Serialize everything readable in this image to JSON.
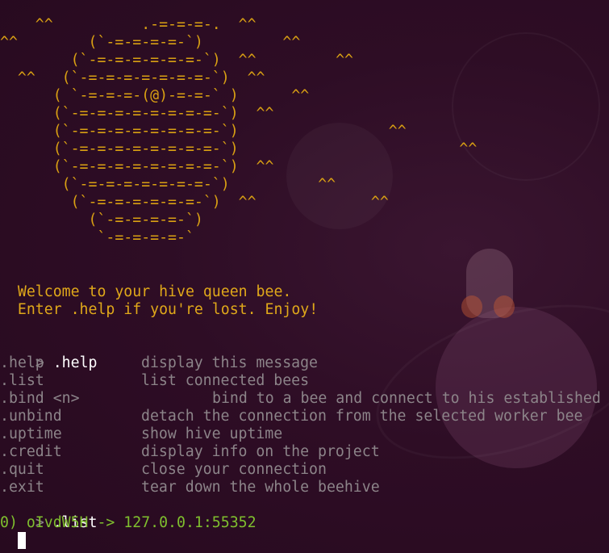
{
  "colors": {
    "background": "#2c0b22",
    "ascii_art": "#d9a013",
    "welcome_text": "#e0a81a",
    "command_text": "#ffffff",
    "help_text": "#8c8489",
    "result_text": "#7fbf2e",
    "prompt": "#8a7f86"
  },
  "ascii_art": [
    "    ^^          .-=-=-=-.  ^^",
    "^^        (`-=-=-=-=-`)         ^^",
    "        (`-=-=-=-=-=-=-`)  ^^         ^^",
    "  ^^   (`-=-=-=-=-=-=-=-`)  ^^",
    "      ( `-=-=-=-(@)-=-=-` )      ^^",
    "      (`-=-=-=-=-=-=-=-=-`)  ^^",
    "      (`-=-=-=-=-=-=-=-=-`)                 ^^",
    "      (`-=-=-=-=-=-=-=-=-`)                         ^^",
    "      (`-=-=-=-=-=-=-=-=-`)  ^^",
    "       (`-=-=-=-=-=-=-=-`)          ^^",
    "        (`-=-=-=-=-=-=-`)  ^^             ^^",
    "          (`-=-=-=-=-`)",
    "           `-=-=-=-=-`"
  ],
  "welcome": {
    "line1": "  Welcome to your hive queen bee.",
    "line2": "  Enter .help if you're lost. Enjoy!"
  },
  "prompt_symbol": "> ",
  "session": {
    "cmd_help": ".help",
    "help_entries": [
      {
        "cmd": ".help",
        "desc": "display this message"
      },
      {
        "cmd": ".list",
        "desc": "list connected bees"
      },
      {
        "cmd": ".bind <n>",
        "desc": "bind to a bee and connect to his established"
      },
      {
        "cmd": ".unbind",
        "desc": "detach the connection from the selected worker bee"
      },
      {
        "cmd": ".uptime",
        "desc": "show hive uptime"
      },
      {
        "cmd": ".credit",
        "desc": "display info on the project"
      },
      {
        "cmd": ".quit",
        "desc": "close your connection"
      },
      {
        "cmd": ".exit",
        "desc": "tear down the whole beehive"
      }
    ],
    "cmd_list": ".list",
    "list_result": "0) oIvdW5H -> 127.0.0.1:55352"
  },
  "icons": {
    "cursor": "block-cursor"
  }
}
